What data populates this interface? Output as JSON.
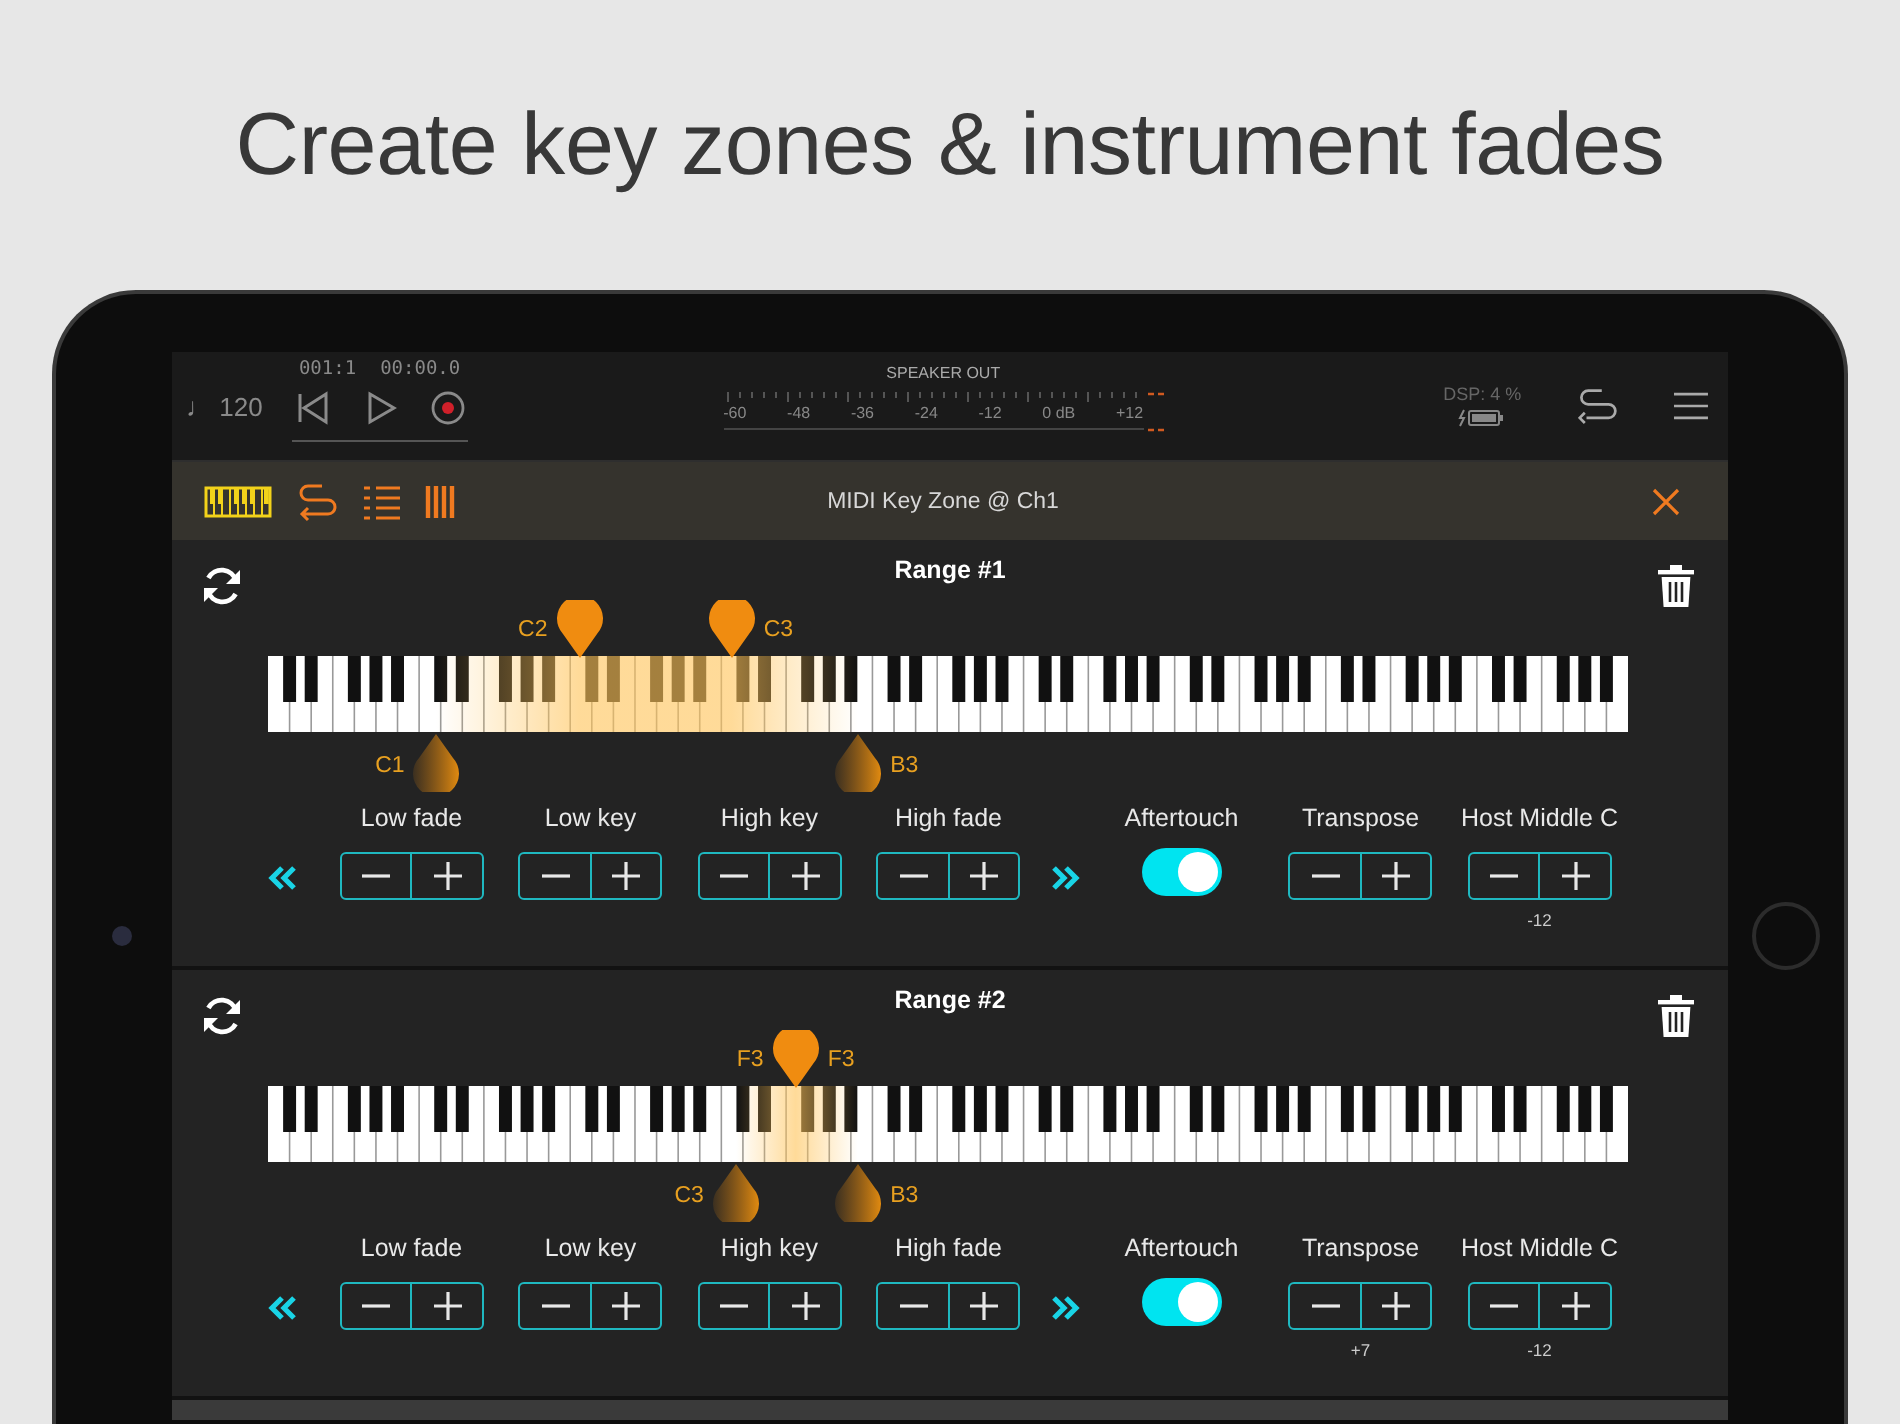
{
  "headline": "Create key zones & instrument fades",
  "transport": {
    "tempo": "♩ 120",
    "position": "001:1",
    "time": "00:00.0"
  },
  "meter": {
    "title": "SPEAKER OUT",
    "scale": [
      "-60",
      "-48",
      "-36",
      "-24",
      "-12",
      "0 dB",
      "+12"
    ]
  },
  "dsp": "DSP: 4 %",
  "toolbar": {
    "title": "MIDI Key Zone @ Ch1",
    "tools": [
      {
        "kind": "keyboard",
        "selected": true
      },
      {
        "kind": "route",
        "selected": false
      },
      {
        "kind": "list",
        "selected": false
      },
      {
        "kind": "bars",
        "selected": false
      }
    ]
  },
  "ranges": [
    {
      "title": "Range #1",
      "low_fade": {
        "label": "C1",
        "level": 0.124
      },
      "low_key": {
        "label": "C2",
        "level": 0.229
      },
      "high_key": {
        "label": "C3",
        "level": 0.341
      },
      "high_fade": {
        "label": "B3",
        "level": 0.434
      },
      "controls": [
        {
          "kind": "stepper",
          "label": "Low fade"
        },
        {
          "kind": "stepper",
          "label": "Low key"
        },
        {
          "kind": "stepper",
          "label": "High key"
        },
        {
          "kind": "stepper",
          "label": "High fade"
        },
        {
          "kind": "toggle",
          "label": "Aftertouch",
          "on": true
        },
        {
          "kind": "stepper",
          "label": "Transpose"
        },
        {
          "kind": "stepper",
          "label": "Host Middle C",
          "value": "-12"
        }
      ]
    },
    {
      "title": "Range #2",
      "low_fade": {
        "label": "C3",
        "level": 0.344
      },
      "low_key": {
        "label": "F3",
        "level": 0.388
      },
      "high_key": {
        "label": "F3",
        "level": 0.388
      },
      "high_fade": {
        "label": "B3",
        "level": 0.434
      },
      "controls": [
        {
          "kind": "stepper",
          "label": "Low fade"
        },
        {
          "kind": "stepper",
          "label": "Low key"
        },
        {
          "kind": "stepper",
          "label": "High key"
        },
        {
          "kind": "stepper",
          "label": "High fade"
        },
        {
          "kind": "toggle",
          "label": "Aftertouch",
          "on": true
        },
        {
          "kind": "stepper",
          "label": "Transpose",
          "value": "+7"
        },
        {
          "kind": "stepper",
          "label": "Host Middle C",
          "value": "-12"
        }
      ]
    }
  ]
}
